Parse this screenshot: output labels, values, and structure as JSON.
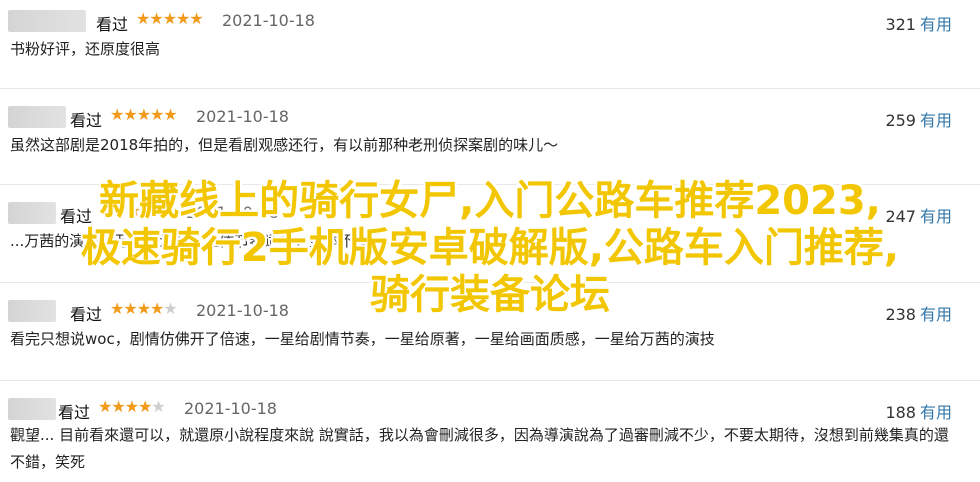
{
  "reviews": [
    {
      "status": "看过",
      "stars": 5,
      "date": "2021-10-18",
      "votes": "321",
      "useful": "有用",
      "text": "书粉好评，还原度很高"
    },
    {
      "status": "看过",
      "stars": 5,
      "date": "2021-10-18",
      "votes": "259",
      "useful": "有用",
      "text": "虽然这部剧是2018年拍的，但是看剧观感还行，有以前那种老刑侦探案剧的味儿～"
    },
    {
      "status": "看过",
      "stars": 5,
      "date": "2021-10-18",
      "votes": "247",
      "useful": "有用",
      "text": "...万茜的演技，万茜的演技，整体节奏适中，整体不错"
    },
    {
      "status": "看过",
      "stars": 4,
      "date": "2021-10-18",
      "votes": "238",
      "useful": "有用",
      "text": "看完只想说woc，剧情仿佛开了倍速，一星给剧情节奏，一星给原著，一星给画面质感，一星给万茜的演技"
    },
    {
      "status": "看过",
      "stars": 4,
      "date": "2021-10-18",
      "votes": "188",
      "useful": "有用",
      "text": "觀望... 目前看來還可以，就還原小說程度來說 說實話，我以為會刪減很多，因為導演說為了過審刪減不少，不要太期待，沒想到前幾集真的還不錯，笑死"
    }
  ],
  "overlay": {
    "line1": "新藏线上的骑行女尸,入门公路车推荐2023,",
    "line2": "极速骑行2手机版安卓破解版,公路车入门推荐,",
    "line3": "骑行装备论坛"
  },
  "colors": {
    "star": "#f19a1c",
    "useful": "#3377aa",
    "overlay": "#f2c600"
  }
}
